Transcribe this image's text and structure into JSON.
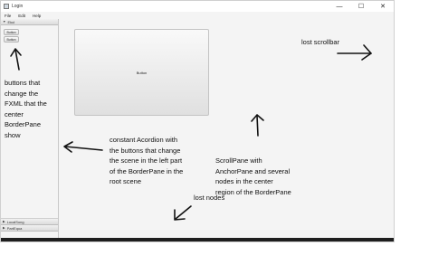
{
  "window": {
    "title": "Login",
    "menu": [
      "File",
      "Edit",
      "Help"
    ],
    "controls": {
      "minimize": "—",
      "maximize": "☐",
      "close": "✕"
    }
  },
  "accordion": {
    "panes": [
      {
        "title": "Ekul",
        "expanded": true
      },
      {
        "title": "LocalSong",
        "expanded": false
      },
      {
        "title": "PartEqua",
        "expanded": false
      }
    ],
    "buttons": [
      "Button",
      "Button"
    ]
  },
  "center": {
    "button_label": "Button"
  },
  "annotations": {
    "lost_scrollbar": "lost scrollbar",
    "buttons_note": [
      "buttons that",
      "change the",
      "FXML that the",
      "center",
      "BorderPane",
      "show"
    ],
    "accordion_note": [
      "constant Acordion with",
      "the buttons that change",
      "the scene in the left part",
      "of the BorderPane in the",
      "root scene"
    ],
    "scrollpane_note": [
      "ScrollPane with",
      "AnchorPane and several",
      "nodes in the center",
      "region of the BorderPane"
    ],
    "lost_nodes": "lost nodes"
  }
}
